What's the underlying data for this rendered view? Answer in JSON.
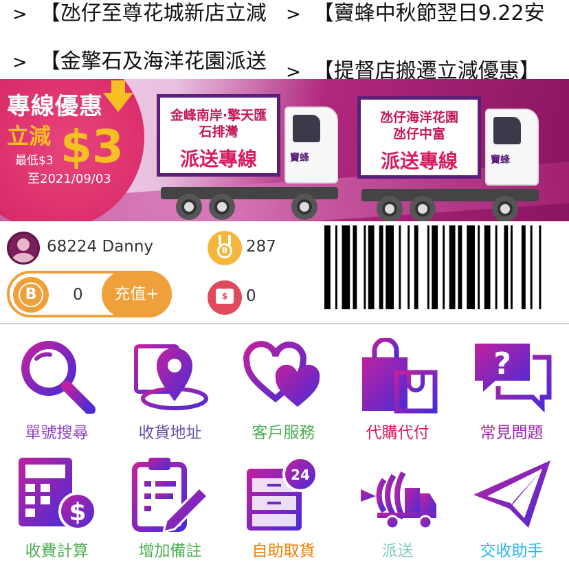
{
  "ticker": {
    "arrow": ">",
    "items": [
      "【氹仔至尊花城新店立減",
      "【竇蜂中秋節翌日9.22安",
      "【金擎石及海洋花園派送",
      "【提督店搬遷立減優惠】"
    ]
  },
  "banner": {
    "promo_title": "專線優惠",
    "promo_sub": "立減",
    "promo_amount": "$3",
    "promo_min": "最低$3",
    "promo_date": "至2021/09/03",
    "trucks": [
      {
        "line1": "金峰南岸·擎天匯",
        "line2": "石排灣",
        "line3": "派送專線",
        "logo": "竇蜂"
      },
      {
        "line1": "氹仔海洋花園",
        "line2": "氹仔中富",
        "line3": "派送專線",
        "logo": "竇蜂"
      }
    ]
  },
  "user": {
    "name": "68224 Danny",
    "points": "287",
    "balance": "0",
    "topup_label": "充值+",
    "coupons": "0"
  },
  "grid": [
    {
      "label": "單號搜尋",
      "icon": "magnifier-icon",
      "color": "#8e44c8"
    },
    {
      "label": "收貨地址",
      "icon": "location-pin-icon",
      "color": "#6a4fa8"
    },
    {
      "label": "客戶服務",
      "icon": "hearts-icon",
      "color": "#4caf50"
    },
    {
      "label": "代購代付",
      "icon": "shopping-bag-icon",
      "color": "#d81b60"
    },
    {
      "label": "常見問題",
      "icon": "question-chat-icon",
      "color": "#9c27b0"
    },
    {
      "label": "收費計算",
      "icon": "calculator-dollar-icon",
      "color": "#4caf50"
    },
    {
      "label": "增加備註",
      "icon": "clipboard-pen-icon",
      "color": "#4caf50"
    },
    {
      "label": "自助取貨",
      "icon": "locker-24h-icon",
      "color": "#f57c00"
    },
    {
      "label": "派送",
      "icon": "delivery-truck-icon",
      "color": "#80cbc4"
    },
    {
      "label": "交收助手",
      "icon": "paper-plane-icon",
      "color": "#29b6f6"
    }
  ],
  "colors": {
    "icon_gradient_start": "#c0219e",
    "icon_gradient_end": "#4a2bd6",
    "accent_orange": "#f0a03a",
    "banner_magenta": "#b0287e"
  }
}
